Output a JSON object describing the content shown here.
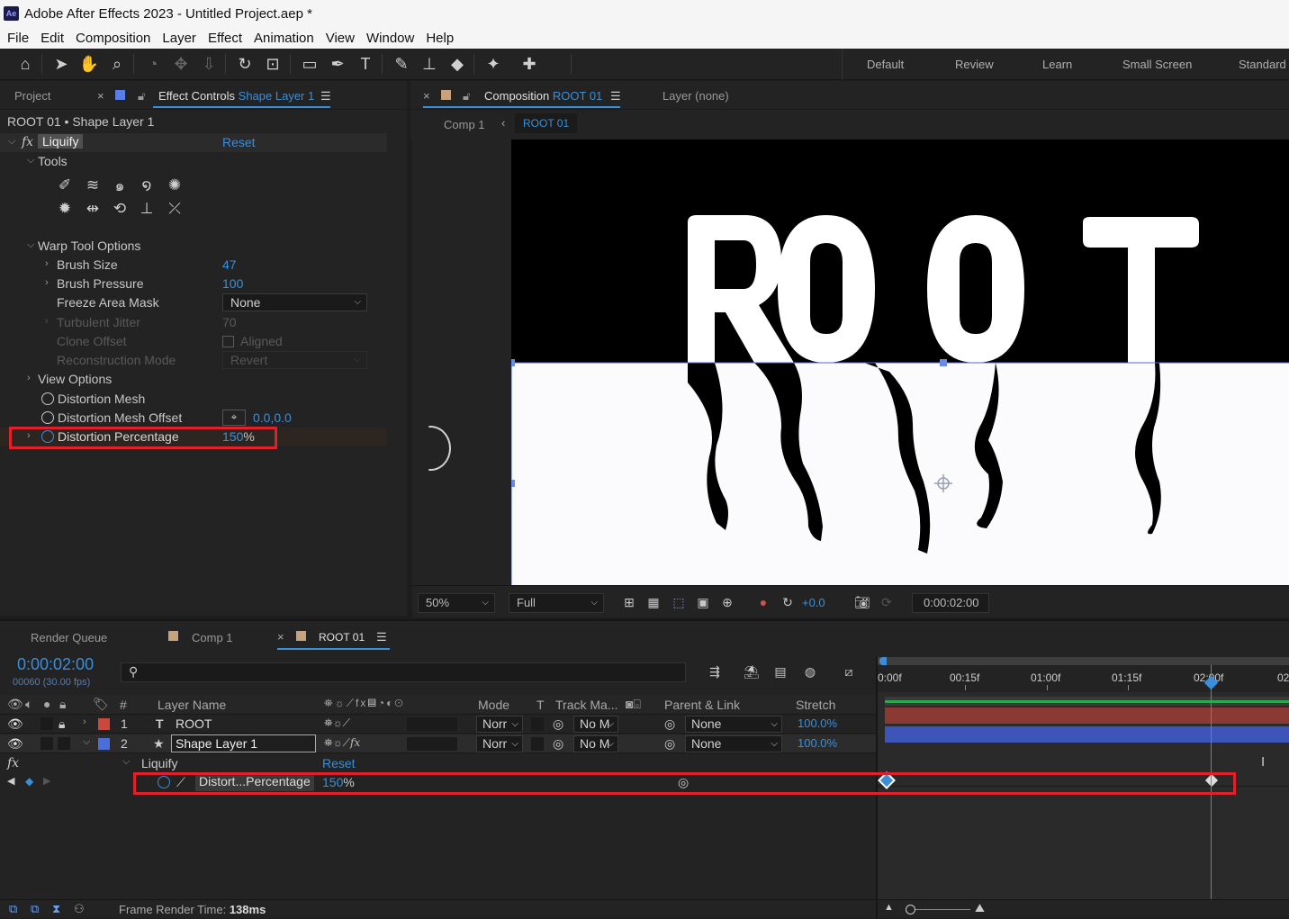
{
  "window": {
    "title": "Adobe After Effects 2023 - Untitled Project.aep *",
    "logo": "Ae"
  },
  "menu": [
    "File",
    "Edit",
    "Composition",
    "Layer",
    "Effect",
    "Animation",
    "View",
    "Window",
    "Help"
  ],
  "workspaces": [
    "Default",
    "Review",
    "Learn",
    "Small Screen",
    "Standard"
  ],
  "left_panel": {
    "tab_project": "Project",
    "tab_effect_controls": "Effect Controls",
    "tab_effect_target": "Shape Layer 1",
    "breadcrumb": "ROOT 01 • Shape Layer 1",
    "effect_name": "Liquify",
    "reset": "Reset",
    "tools_label": "Tools",
    "warp_options": "Warp Tool Options",
    "brush_size": {
      "label": "Brush Size",
      "value": "47"
    },
    "brush_pressure": {
      "label": "Brush Pressure",
      "value": "100"
    },
    "freeze_area_mask": {
      "label": "Freeze Area Mask",
      "value": "None"
    },
    "turbulent_jitter": {
      "label": "Turbulent Jitter",
      "value": "70"
    },
    "clone_offset": {
      "label": "Clone Offset",
      "value": "Aligned"
    },
    "reconstruction_mode": {
      "label": "Reconstruction Mode",
      "value": "Revert"
    },
    "view_options": "View Options",
    "distortion_mesh": "Distortion Mesh",
    "distortion_mesh_offset": {
      "label": "Distortion Mesh Offset",
      "value": "0.0,0.0"
    },
    "distortion_percentage": {
      "label": "Distortion Percentage",
      "value": "150",
      "unit": "%"
    }
  },
  "comp_panel": {
    "tab_label": "Composition",
    "tab_comp": "ROOT 01",
    "layer_tab": "Layer (none)",
    "sub_tabs": [
      "Comp 1",
      "ROOT 01"
    ],
    "artwork_text": "ROOT",
    "zoom": "50%",
    "resolution": "Full",
    "exposure": "+0.0",
    "timecode": "0:00:02:00"
  },
  "timeline": {
    "tabs": [
      "Render Queue",
      "Comp 1",
      "ROOT 01"
    ],
    "timecode": "0:00:02:00",
    "frame_info": "00060 (30.00 fps)",
    "search_placeholder": "",
    "headers": {
      "num": "#",
      "layer_name": "Layer Name",
      "mode": "Mode",
      "t": "T",
      "track_matte": "Track Ma...",
      "parent": "Parent & Link",
      "stretch": "Stretch"
    },
    "ruler": [
      "0:00f",
      "00:15f",
      "01:00f",
      "01:15f",
      "02:00f",
      "02"
    ],
    "layers": [
      {
        "num": "1",
        "type_icon": "T",
        "name": "ROOT",
        "mode": "Norr",
        "matte": "No M",
        "parent": "None",
        "stretch": "100.0%",
        "color": "#c94a3c"
      },
      {
        "num": "2",
        "type_icon": "★",
        "name": "Shape Layer 1",
        "mode": "Norr",
        "matte": "No M",
        "parent": "None",
        "stretch": "100.0%",
        "color": "#4a6fd8"
      }
    ],
    "fx_row": {
      "fx": "fx",
      "name": "Liquify",
      "reset": "Reset"
    },
    "prop_row": {
      "name": "Distort...Percentage",
      "value": "150",
      "unit": "%"
    }
  },
  "status": {
    "label": "Frame Render Time:",
    "value": "138ms"
  },
  "colors": {
    "accent": "#3b8ed8",
    "highlight": "#e0202a",
    "layer1": "#c94a3c",
    "layer2": "#4a6fd8"
  }
}
